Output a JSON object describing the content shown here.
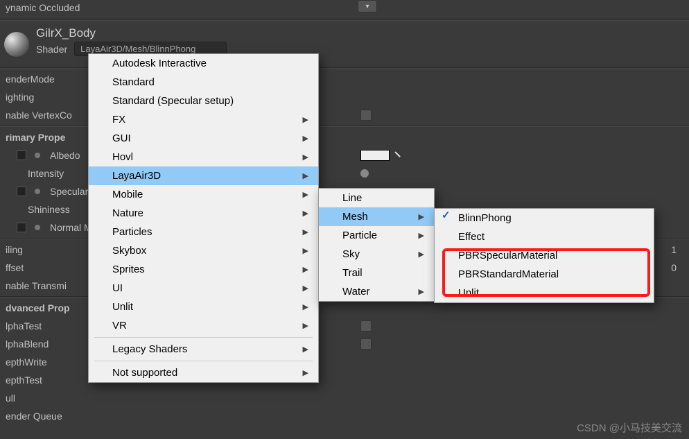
{
  "top_truncated": "ynamic Occluded",
  "material": {
    "name": "GilrX_Body",
    "shader_label": "Shader",
    "shader_value": "LayaAir3D/Mesh/BlinnPhong"
  },
  "inspector": {
    "render_mode": "enderMode",
    "lighting": "ighting",
    "enable_vertex": "nable VertexCo",
    "primary_prop": "rimary Prope",
    "albedo": "Albedo",
    "intensity": "Intensity",
    "specular": "Specular",
    "shininess": "Shininess",
    "normal_map": "Normal Ma",
    "tiling": "iling",
    "offset": "ffset",
    "enable_trans": "nable Transmi",
    "advanced_prop": "dvanced Prop",
    "alpha_test": "lphaTest",
    "alpha_blend": "lphaBlend",
    "depth_write": "epthWrite",
    "depth_test": "epthTest",
    "cull": "ull",
    "render_queue": "ender Queue",
    "val1": "1",
    "val0": "0"
  },
  "menu1": {
    "autodesk": "Autodesk Interactive",
    "standard": "Standard",
    "standard_spec": "Standard (Specular setup)",
    "fx": "FX",
    "gui": "GUI",
    "hovl": "Hovl",
    "laya": "LayaAir3D",
    "mobile": "Mobile",
    "nature": "Nature",
    "particles": "Particles",
    "skybox": "Skybox",
    "sprites": "Sprites",
    "ui": "UI",
    "unlit": "Unlit",
    "vr": "VR",
    "legacy": "Legacy Shaders",
    "not_supported": "Not supported"
  },
  "menu2": {
    "line": "Line",
    "mesh": "Mesh",
    "particle": "Particle",
    "sky": "Sky",
    "trail": "Trail",
    "water": "Water"
  },
  "menu3": {
    "blinn": "BlinnPhong",
    "effect": "Effect",
    "pbr_spec": "PBRSpecularMaterial",
    "pbr_std": "PBRStandardMaterial",
    "unlit": "Unlit"
  },
  "watermark": "CSDN @小马技美交流"
}
